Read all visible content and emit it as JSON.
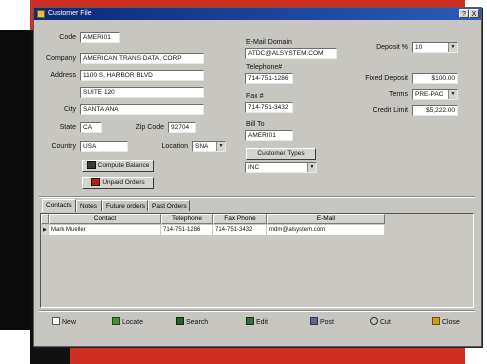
{
  "window": {
    "title": "Customer File",
    "controls": [
      "?",
      "X"
    ]
  },
  "customer": {
    "code": {
      "label": "Code",
      "value": "AMERI01"
    },
    "company": {
      "label": "Company",
      "value": "AMERICAN TRANS DATA, CORP"
    },
    "address": {
      "label": "Address",
      "line1": "1100 S. HARBOR BLVD",
      "line2": "SUITE 120"
    },
    "city": {
      "label": "City",
      "value": "SANTA ANA"
    },
    "state": {
      "label": "State",
      "value": "CA"
    },
    "zip": {
      "label": "Zip Code",
      "value": "92704"
    },
    "country": {
      "label": "Country",
      "value": "USA"
    },
    "location": {
      "label": "Location",
      "value": "SNA"
    },
    "compute_balance_label": "Compute Balance",
    "unpaid_orders_label": "Unpaid Orders"
  },
  "contact_info": {
    "email_domain": {
      "label": "E-Mail Domain",
      "value": "ATDC@ALSYSTEM.COM"
    },
    "telephone": {
      "label": "Telephone#",
      "value": "714-751-1286"
    },
    "fax": {
      "label": "Fax #",
      "value": "714-751-3432"
    },
    "bill_to": {
      "label": "Bill To",
      "value": "AMERI01"
    },
    "customer_types_label": "Customer Types",
    "customer_type_value": "INC"
  },
  "terms": {
    "deposit": {
      "label": "Deposit %",
      "value": "10"
    },
    "fixed_deposit": {
      "label": "Fixed Deposit",
      "value": "$100.00"
    },
    "terms": {
      "label": "Terms",
      "value": "PRE-PAC"
    },
    "credit_limit": {
      "label": "Credit Limit",
      "value": "$5,222.00"
    }
  },
  "tabs": [
    {
      "label": "Contacts"
    },
    {
      "label": "Notes"
    },
    {
      "label": "Future orders"
    },
    {
      "label": "Past Orders"
    }
  ],
  "contacts_table": {
    "columns": [
      "Contact",
      "Telephone",
      "Fax Phone",
      "E-Mail"
    ],
    "rows": [
      {
        "marker": "▶",
        "contact": "Mark Mueller",
        "telephone": "714-751-1286",
        "fax": "714-751-3432",
        "email": "mdm@alsystem.com"
      }
    ]
  },
  "toolbar": {
    "new": "New",
    "locate": "Locate",
    "search": "Search",
    "edit": "Edit",
    "post": "Post",
    "cut": "Cut",
    "close": "Close"
  },
  "colors": {
    "accent_red": "#cf2f23",
    "title_blue": "#0b2a78",
    "window_gray": "#c7c6c0"
  }
}
